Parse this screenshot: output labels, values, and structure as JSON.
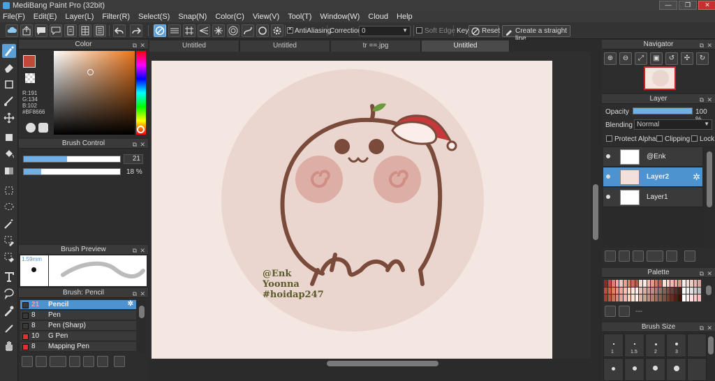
{
  "window": {
    "title": "MediBang Paint Pro (32bit)",
    "minimize": "—",
    "restore": "❐",
    "close": "✕"
  },
  "menu": [
    "File(F)",
    "Edit(E)",
    "Layer(L)",
    "Filter(R)",
    "Select(S)",
    "Snap(N)",
    "Color(C)",
    "View(V)",
    "Tool(T)",
    "Window(W)",
    "Cloud",
    "Help"
  ],
  "toolbar": {
    "antialiasing_label": "AntiAliasing",
    "correction_label": "Correction",
    "correction_value": "0",
    "soft_edge_label": "Soft Edge",
    "key_label": "Key",
    "reset_label": "Reset",
    "straight_line_label": "Create a straight line"
  },
  "color_panel": {
    "title": "Color",
    "r": "R:191",
    "g": "G:134",
    "b": "B:102",
    "hex": "#BF8666",
    "fg_color": "#BF4A3A",
    "bg_color": "#FFFFFF",
    "hue_color": "#E8741A"
  },
  "brush_control": {
    "title": "Brush Control",
    "size_value": "21",
    "size_fraction": 0.45,
    "opacity_value": "18 %",
    "opacity_fraction": 0.18
  },
  "brush_preview": {
    "title": "Brush Preview",
    "size_label": "1.59mm"
  },
  "brush_list": {
    "title": "Brush: Pencil",
    "items": [
      {
        "size": "21",
        "name": "Pencil",
        "color": "#3a3a3a"
      },
      {
        "size": "8",
        "name": "Pen",
        "color": "#3a3a3a"
      },
      {
        "size": "8",
        "name": "Pen (Sharp)",
        "color": "#3a3a3a"
      },
      {
        "size": "10",
        "name": "G Pen",
        "color": "#e03030"
      },
      {
        "size": "8",
        "name": "Mapping Pen",
        "color": "#e03030"
      }
    ]
  },
  "tabs": [
    "Untitled",
    "Untitled",
    "tr ==.jpg",
    "Untitled"
  ],
  "canvas": {
    "signature_line1": "@Enk",
    "signature_line2": "Yoonna",
    "signature_line3": "#hoidap247",
    "circle_color": "#ead6ce",
    "line_color": "#7a4a3a",
    "cheek_color": "#d9a79e",
    "hat_color": "#c7383a"
  },
  "navigator": {
    "title": "Navigator"
  },
  "layer_panel": {
    "title": "Layer",
    "opacity_label": "Opacity",
    "opacity_value": "100 %",
    "opacity_fraction": 1.0,
    "blending_label": "Blending",
    "blending_value": "Normal",
    "protect_alpha_label": "Protect Alpha",
    "clipping_label": "Clipping",
    "lock_label": "Lock",
    "layers": [
      {
        "name": "@Enk",
        "selected": false
      },
      {
        "name": "Layer2",
        "selected": true
      },
      {
        "name": "Layer1",
        "selected": false
      }
    ]
  },
  "palette": {
    "title": "Palette",
    "no_color_label": "---",
    "colors": [
      "#8a2b2b",
      "#c84a4a",
      "#e07a7a",
      "#f0a8a8",
      "#f5c4c4",
      "#e8a090",
      "#d87d6e",
      "#c86a5a",
      "#b05a4a",
      "#f8d8d0",
      "#fce8e4",
      "#f2b8b0",
      "#e29a8e",
      "#d4786a",
      "#c05e52",
      "#f9e0da",
      "#f6cfc7",
      "#eebcb3",
      "#e6a89e",
      "#dc9488",
      "#f8ece8",
      "#f3dcd6",
      "#eccbc3",
      "#e4b9b0",
      "#dba79c",
      "#b85040",
      "#d06050",
      "#e87868",
      "#f09080",
      "#f8a898",
      "#ffc0b0",
      "#ffd8c8",
      "#ffe8e0",
      "#fff0ea",
      "#e8c0b8",
      "#d8b0a8",
      "#c8a098",
      "#b89088",
      "#a88078",
      "#987068",
      "#886058",
      "#785048",
      "#684038",
      "#583028",
      "#482018",
      "#ffffff",
      "#f0f0f0",
      "#e0e0e0",
      "#d0d0d0",
      "#c0c0c0",
      "#a04030",
      "#b85848",
      "#c87060",
      "#d88878",
      "#e8a090",
      "#f0b8a8",
      "#f8d0c0",
      "#fce0d4",
      "#fff0e8",
      "#e0b0a0",
      "#d0a090",
      "#c09080",
      "#b08070",
      "#a07060",
      "#906050",
      "#805040",
      "#704030",
      "#603020",
      "#502010",
      "#401000",
      "#ffffff",
      "#ffeeee",
      "#ffdddd",
      "#ffcccc",
      "#ffbbbb"
    ]
  },
  "brush_size": {
    "title": "Brush Size",
    "sizes": [
      "1",
      "1.5",
      "2",
      "3"
    ]
  }
}
